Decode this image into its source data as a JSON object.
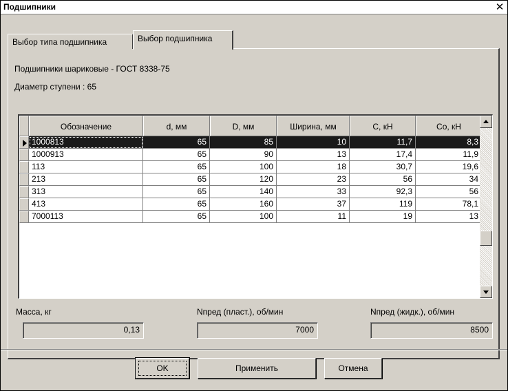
{
  "window": {
    "title": "Подшипники",
    "close_symbol": "✕"
  },
  "tabs": [
    {
      "label": "Выбор типа подшипника",
      "active": false
    },
    {
      "label": "Выбор подшипника",
      "active": true
    }
  ],
  "info": {
    "type_line": "Подшипники шариковые - ГОСТ 8338-75",
    "diameter_line": "Диаметр ступени : 65"
  },
  "table": {
    "columns": [
      "Обозначение",
      "d, мм",
      "D, мм",
      "Ширина, мм",
      "C, кН",
      "Co, кН"
    ],
    "rows": [
      [
        "1000813",
        "65",
        "85",
        "10",
        "11,7",
        "8,3"
      ],
      [
        "1000913",
        "65",
        "90",
        "13",
        "17,4",
        "11,9"
      ],
      [
        "113",
        "65",
        "100",
        "18",
        "30,7",
        "19,6"
      ],
      [
        "213",
        "65",
        "120",
        "23",
        "56",
        "34"
      ],
      [
        "313",
        "65",
        "140",
        "33",
        "92,3",
        "56"
      ],
      [
        "413",
        "65",
        "160",
        "37",
        "119",
        "78,1"
      ],
      [
        "7000113",
        "65",
        "100",
        "11",
        "19",
        "13"
      ]
    ],
    "selected_row": 0
  },
  "fields": {
    "mass": {
      "label": "Масса, кг",
      "value": "0,13"
    },
    "n_plast": {
      "label": "Nпред (пласт.), об/мин",
      "value": "7000"
    },
    "n_zhidk": {
      "label": "Nпред (жидк.), об/мин",
      "value": "8500"
    }
  },
  "buttons": {
    "ok": "OK",
    "apply": "Применить",
    "cancel": "Отмена"
  },
  "colors": {
    "face": "#d4d0c8",
    "selection": "#1a1a1a"
  }
}
